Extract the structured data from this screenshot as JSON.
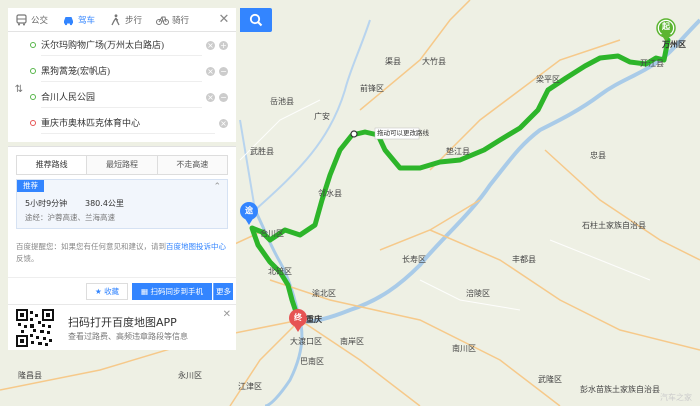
{
  "modes": [
    {
      "label": "公交",
      "icon": "bus-icon"
    },
    {
      "label": "驾车",
      "icon": "car-icon",
      "active": true
    },
    {
      "label": "步行",
      "icon": "walk-icon"
    },
    {
      "label": "骑行",
      "icon": "bike-icon"
    }
  ],
  "stops": [
    {
      "text": "沃尔玛购物广场(万州太白路店)",
      "type": "start"
    },
    {
      "text": "黑狗蒿笼(宏帆店)",
      "type": "via"
    },
    {
      "text": "合川人民公园",
      "type": "via"
    },
    {
      "text": "重庆市奥林匹克体育中心",
      "type": "end"
    }
  ],
  "route_tabs": [
    "推荐路线",
    "最短路程",
    "不走高速"
  ],
  "plan": {
    "badge": "推荐",
    "time": "5小时9分钟",
    "distance": "380.4公里",
    "via": "途经：沪蓉高速、兰海高速"
  },
  "notice": {
    "text": "百度提醒您：如果您有任何意见和建议，请到",
    "link": "百度地图投诉中心",
    "tail": "反馈。"
  },
  "actions": {
    "fav": "收藏",
    "send": "扫码同步到手机",
    "more": "更多"
  },
  "ad": {
    "title": "扫码打开百度地图APP",
    "subtitle": "查看过路费、高频违章路段等信息"
  },
  "map": {
    "tooltip": "拖动可以更改路线",
    "markers": {
      "start": "起",
      "via": "途",
      "end": "终"
    },
    "labels": [
      {
        "t": "渠县",
        "cls": "city"
      },
      {
        "t": "大竹县",
        "cls": "city"
      },
      {
        "t": "开江县",
        "cls": "city"
      },
      {
        "t": "万州区",
        "cls": "dark"
      },
      {
        "t": "岳池县",
        "cls": "city"
      },
      {
        "t": "前锋区",
        "cls": "city"
      },
      {
        "t": "广安",
        "cls": "city"
      },
      {
        "t": "梁平区",
        "cls": "city"
      },
      {
        "t": "忠县",
        "cls": "city"
      },
      {
        "t": "武胜县",
        "cls": "city"
      },
      {
        "t": "邻水县",
        "cls": "city"
      },
      {
        "t": "垫江县",
        "cls": "city"
      },
      {
        "t": "合川区",
        "cls": "city"
      },
      {
        "t": "长寿区",
        "cls": "city"
      },
      {
        "t": "丰都县",
        "cls": "city"
      },
      {
        "t": "石柱土家族自治县",
        "cls": "city"
      },
      {
        "t": "北碚区",
        "cls": "city"
      },
      {
        "t": "渝北区",
        "cls": "city"
      },
      {
        "t": "涪陵区",
        "cls": "city"
      },
      {
        "t": "重庆",
        "cls": "dark"
      },
      {
        "t": "大渡口区",
        "cls": "city"
      },
      {
        "t": "南岸区",
        "cls": "city"
      },
      {
        "t": "巴南区",
        "cls": "city"
      },
      {
        "t": "隆昌县",
        "cls": "city"
      },
      {
        "t": "永川区",
        "cls": "city"
      },
      {
        "t": "江津区",
        "cls": "city"
      },
      {
        "t": "南川区",
        "cls": "city"
      },
      {
        "t": "武隆区",
        "cls": "city"
      },
      {
        "t": "彭水苗族土家族自治县",
        "cls": "city"
      }
    ]
  },
  "watermark": "汽车之家"
}
